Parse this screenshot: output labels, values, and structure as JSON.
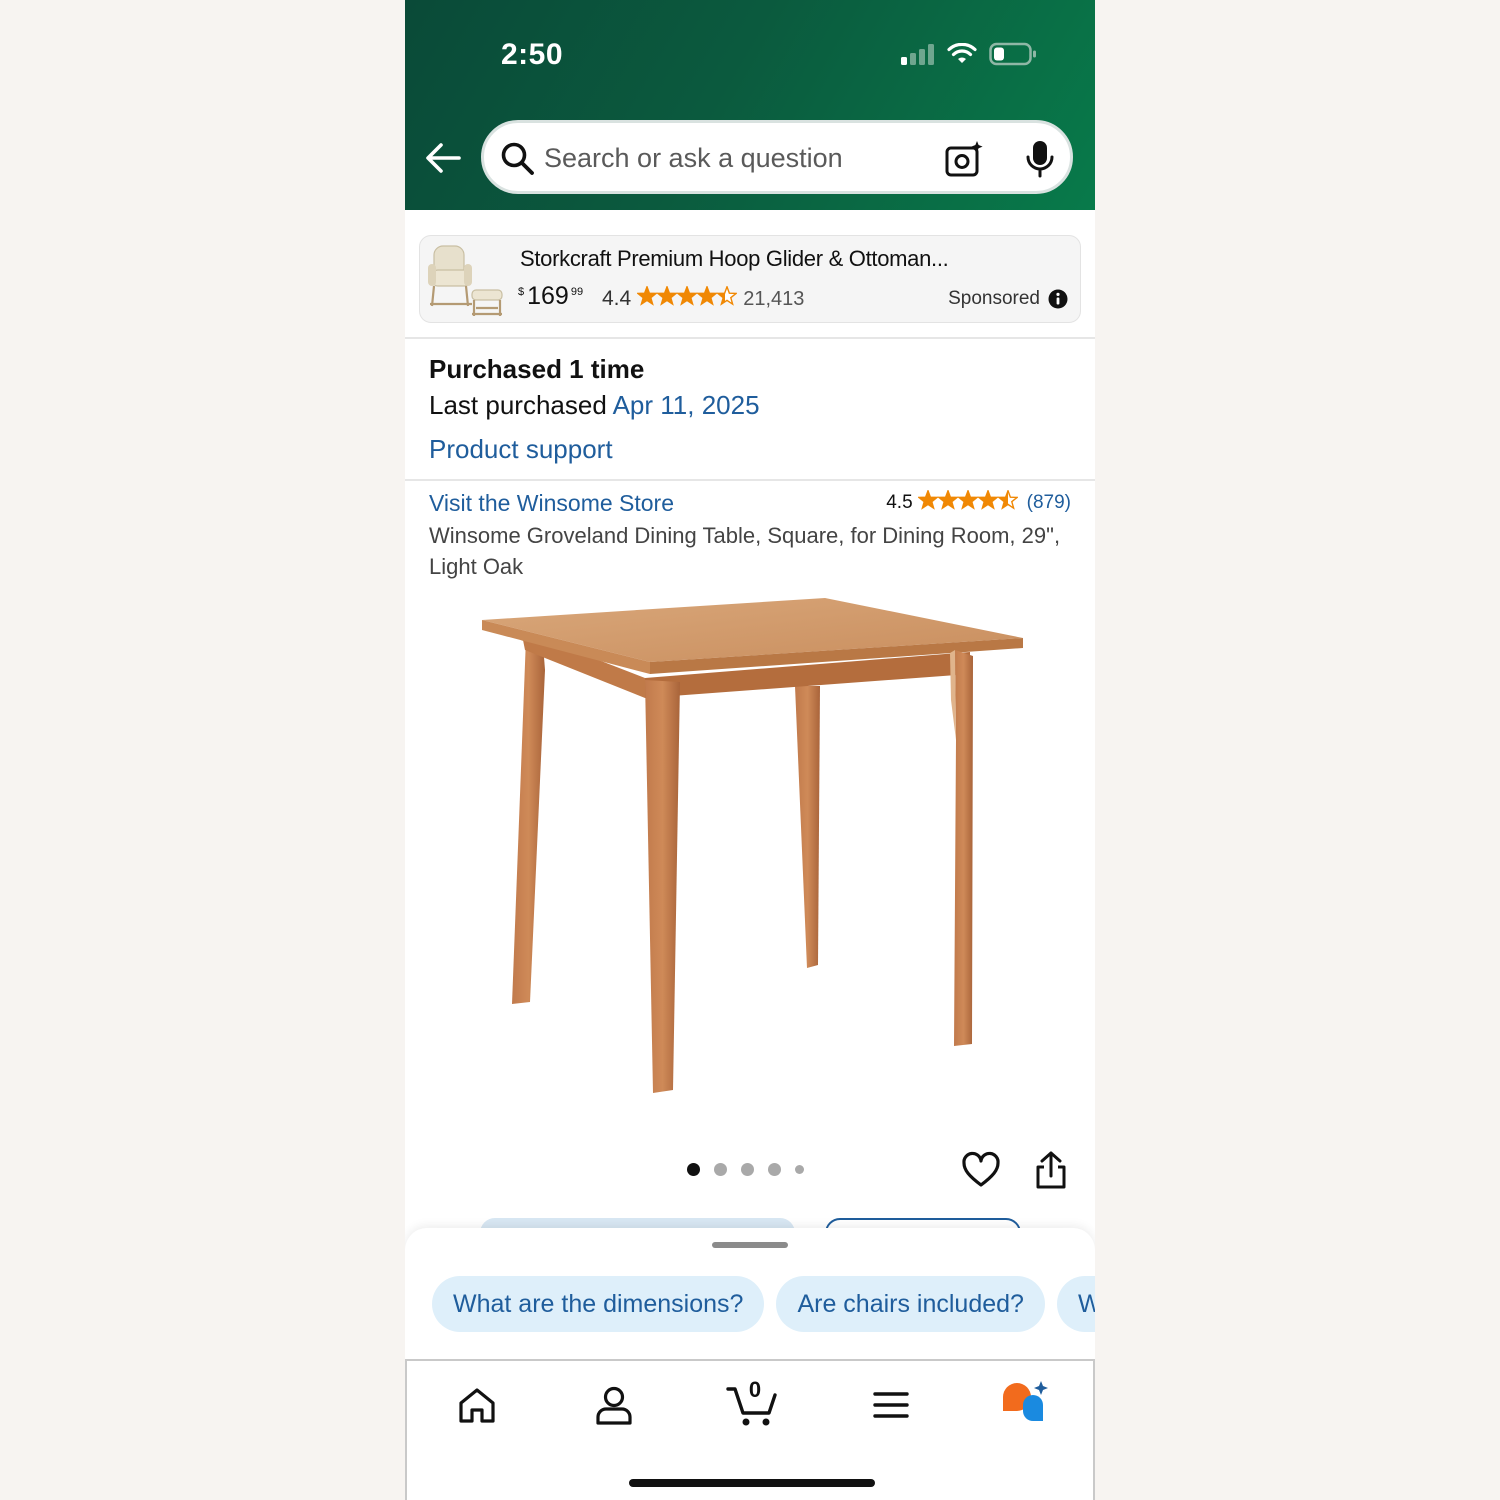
{
  "status_bar": {
    "time": "2:50"
  },
  "search": {
    "placeholder": "Search or ask a question"
  },
  "sponsored_ad": {
    "title": "Storkcraft Premium Hoop Glider & Ottoman...",
    "price_currency": "$",
    "price_whole": "169",
    "price_fraction": "99",
    "rating": "4.4",
    "stars": 4.4,
    "review_count": "21,413",
    "sponsored_label": "Sponsored"
  },
  "purchase_info": {
    "purchased_count": "Purchased 1 time",
    "last_purchased_label": "Last purchased",
    "last_purchased_date": "Apr 11, 2025",
    "product_support": "Product support"
  },
  "product": {
    "store_link": "Visit the Winsome Store",
    "rating": "4.5",
    "stars": 4.5,
    "review_count": "(879)",
    "title": "Winsome Groveland Dining Table, Square, for Dining Room, 29\", Light Oak",
    "image_count": 5,
    "active_image": 1
  },
  "suggestions": {
    "chips": [
      "What are the dimensions?",
      "Are chairs included?",
      "W"
    ]
  },
  "tab_bar": {
    "cart_count": "0",
    "items": [
      "home-icon",
      "account-icon",
      "cart-icon",
      "menu-icon",
      "rufus-icon"
    ]
  },
  "colors": {
    "header_dark": "#0a4a38",
    "header_light": "#087a4a",
    "link_blue": "#1f5d9c",
    "star_orange": "#f08804",
    "chip_bg": "#deeffa"
  }
}
